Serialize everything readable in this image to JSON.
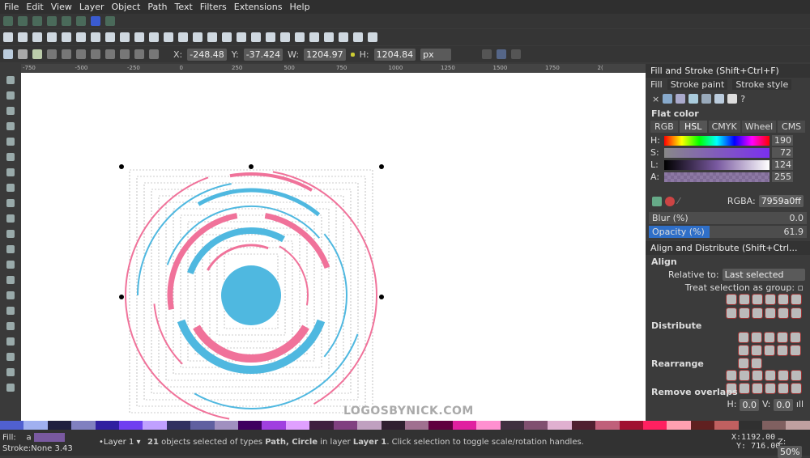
{
  "menu": [
    "File",
    "Edit",
    "View",
    "Layer",
    "Object",
    "Path",
    "Text",
    "Filters",
    "Extensions",
    "Help"
  ],
  "snap_icons": [
    "snap-toggle-icon",
    "snap-bbox-icon",
    "snap-node-icon",
    "snap-path-icon",
    "snap-center-icon",
    "snap-page-icon",
    "grid-icon",
    "guide-icon"
  ],
  "command_icons": [
    "new-document-icon",
    "open-icon",
    "save-icon",
    "print-icon",
    "import-icon",
    "export-icon",
    "undo-icon",
    "redo-icon",
    "copy-icon",
    "cut-icon",
    "paste-icon",
    "zoom-selection-icon",
    "zoom-drawing-icon",
    "zoom-page-icon",
    "duplicate-icon",
    "clone-icon",
    "unlink-clone-icon",
    "group-icon",
    "ungroup-icon",
    "fill-stroke-icon",
    "text-font-icon",
    "layers-icon",
    "xml-editor-icon",
    "align-icon",
    "preferences-icon",
    "document-properties-icon"
  ],
  "select_tool": {
    "x_label": "X:",
    "x": "-248.48",
    "y_label": "Y:",
    "y": "-37.424",
    "w_label": "W:",
    "w": "1204.97",
    "h_label": "H:",
    "h": "1204.84",
    "unit": "px"
  },
  "ruler_ticks": [
    "-750",
    "-500",
    "-250",
    "0",
    "250",
    "500",
    "750",
    "1000",
    "1250",
    "1500",
    "1750",
    "2("
  ],
  "watermark": "LOGOSBYNICK.COM",
  "fill_stroke": {
    "title": "Fill and Stroke (Shift+Ctrl+F)",
    "tabs": [
      "Fill",
      "Stroke paint",
      "Stroke style"
    ],
    "mode": "Flat color",
    "color_tabs": [
      "RGB",
      "HSL",
      "CMYK",
      "Wheel",
      "CMS"
    ],
    "active_color_tab": "HSL",
    "sliders": [
      {
        "label": "H:",
        "value": "190"
      },
      {
        "label": "S:",
        "value": "72"
      },
      {
        "label": "L:",
        "value": "124"
      },
      {
        "label": "A:",
        "value": "255"
      }
    ],
    "rgba_label": "RGBA:",
    "rgba": "7959a0ff",
    "blur_label": "Blur (%)",
    "blur": "0.0",
    "opacity_label": "Opacity (%)",
    "opacity": "61.9",
    "opacity_fraction": 0.619,
    "color": "#7959a0"
  },
  "align": {
    "title": "Align and Distribute (Shift+Ctrl...",
    "align_heading": "Align",
    "relative_label": "Relative to:",
    "relative_value": "Last selected",
    "group_label": "Treat selection as group:",
    "distribute_heading": "Distribute",
    "rearrange_heading": "Rearrange",
    "overlaps_heading": "Remove overlaps",
    "h_label": "H:",
    "h": "0.0",
    "v_label": "V:",
    "v": "0.0"
  },
  "status": {
    "fill_label": "Fill:",
    "fill_a": "a",
    "stroke_label": "Stroke:",
    "stroke_value": "None 3.43",
    "layer": "•Layer 1",
    "message_count": "21",
    "message_pre": " objects selected of types ",
    "types": "Path, Circle",
    "message_mid": " in layer ",
    "layer_name": "Layer 1",
    "message_post": ". Click selection to toggle scale/rotation handles.",
    "x_label": "X:",
    "x": "1192.00",
    "y_label": "Y:",
    "y": "716.00",
    "zoom_label": "Z:",
    "zoom": "50%"
  },
  "colors": {
    "pink": "#f0729a",
    "blue": "#4fb8e0"
  }
}
